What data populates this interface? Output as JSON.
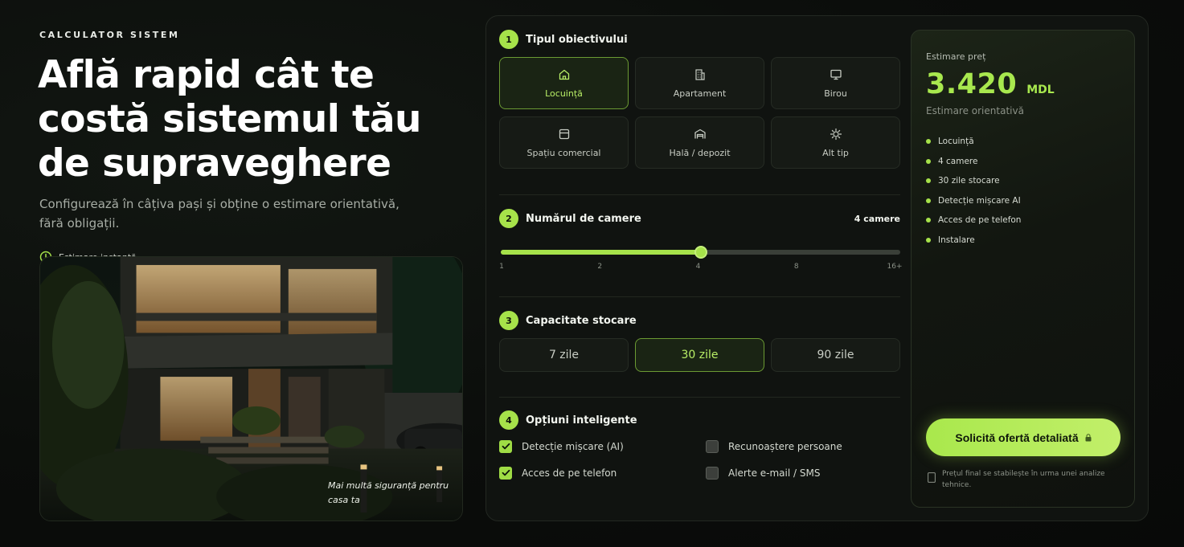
{
  "hero": {
    "eyebrow": "CALCULATOR SISTEM",
    "title": "Află rapid cât te costă sistemul tău de supraveghere",
    "subtitle": "Configurează în câțiva pași și obține o estimare orientativă, fără obligații.",
    "badge": "Estimare instantă",
    "image_caption": "Mai multă siguranță pentru casa ta"
  },
  "steps": {
    "type": {
      "number": "1",
      "title": "Tipul obiectivului",
      "options": [
        {
          "label": "Locuință",
          "icon": "home-icon",
          "selected": true
        },
        {
          "label": "Apartament",
          "icon": "building-icon",
          "selected": false
        },
        {
          "label": "Birou",
          "icon": "monitor-icon",
          "selected": false
        },
        {
          "label": "Spațiu comercial",
          "icon": "store-icon",
          "selected": false
        },
        {
          "label": "Hală / depozit",
          "icon": "warehouse-icon",
          "selected": false
        },
        {
          "label": "Alt tip",
          "icon": "sun-icon",
          "selected": false
        }
      ]
    },
    "cameras": {
      "number": "2",
      "title": "Numărul de camere",
      "value_label": "4 camere",
      "value": 4,
      "ticks": [
        "1",
        "2",
        "4",
        "8",
        "16+"
      ],
      "selected_tick": "4"
    },
    "storage": {
      "number": "3",
      "title": "Capacitate stocare",
      "options": [
        {
          "label": "7 zile",
          "selected": false
        },
        {
          "label": "30 zile",
          "selected": true
        },
        {
          "label": "90 zile",
          "selected": false
        }
      ]
    },
    "smart": {
      "number": "4",
      "title": "Opțiuni inteligente",
      "options": [
        {
          "label": "Detecție mișcare (AI)",
          "checked": true
        },
        {
          "label": "Recunoaștere persoane",
          "checked": false
        },
        {
          "label": "Acces de pe telefon",
          "checked": true
        },
        {
          "label": "Alerte e-mail / SMS",
          "checked": false
        }
      ]
    }
  },
  "estimate": {
    "label": "Estimare preț",
    "amount": "3.420",
    "currency": "MDL",
    "note": "Estimare orientativă",
    "summary": [
      "Locuință",
      "4 camere",
      "30 zile stocare",
      "Detecție mișcare AI",
      "Acces de pe telefon",
      "Instalare"
    ],
    "cta": "Solicită ofertă detaliată",
    "fine_print": "Prețul final se stabilește în urma unei analize tehnice."
  },
  "colors": {
    "accent": "#a6e24a",
    "background": "#0b0d0b",
    "panel": "#101310"
  }
}
